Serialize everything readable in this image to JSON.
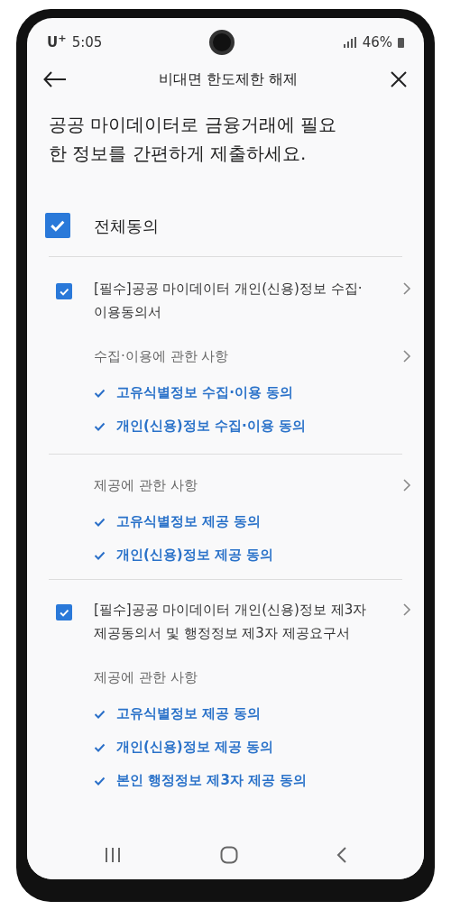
{
  "status_bar": {
    "carrier": "U$^{+}$",
    "time": "5:05",
    "battery": "46%"
  },
  "header": {
    "title": "비대면 한도제한 해제"
  },
  "heading": "공공 마이데이터로 금융거래에 필요한 정보를 간편하게 제출하세요.",
  "all_agree": {
    "label": "전체동의",
    "checked": true
  },
  "sections": [
    {
      "label": "[필수]공공 마이데이터 개인(신용)정보 수집·이용동의서",
      "checked": true,
      "groups": [
        {
          "title": "수집·이용에 관한 사항",
          "kind": "link",
          "items": [
            {
              "label": "고유식별정보 수집·이용 동의",
              "checked": true
            },
            {
              "label": "개인(신용)정보 수집·이용 동의",
              "checked": true
            }
          ]
        },
        {
          "title": "제공에 관한 사항",
          "kind": "link",
          "items": [
            {
              "label": "고유식별정보 제공 동의",
              "checked": true
            },
            {
              "label": "개인(신용)정보 제공 동의",
              "checked": true
            }
          ]
        }
      ]
    },
    {
      "label": "[필수]공공 마이데이터 개인(신용)정보 제3자 제공동의서 및 행정정보 제3자 제공요구서",
      "checked": true,
      "groups": [
        {
          "title": "제공에 관한 사항",
          "kind": "plain",
          "items": [
            {
              "label": "고유식별정보 제공 동의",
              "checked": true
            },
            {
              "label": "개인(신용)정보 제공 동의",
              "checked": true
            },
            {
              "label": "본인 행정정보 제3자 제공 동의",
              "checked": true
            }
          ]
        }
      ]
    }
  ]
}
